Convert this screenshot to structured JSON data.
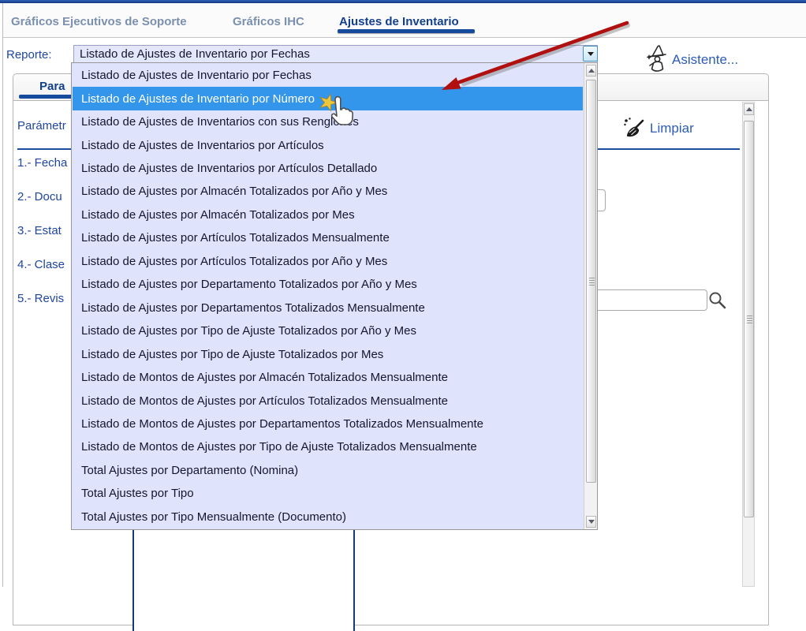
{
  "tabs": [
    {
      "label": "Gráficos Ejecutivos de Soporte",
      "active": false
    },
    {
      "label": "Gráficos IHC",
      "active": false
    },
    {
      "label": "Ajustes de Inventario",
      "active": true
    }
  ],
  "report": {
    "label": "Reporte:",
    "selected_value": "Listado de Ajustes de Inventario por Fechas"
  },
  "assistant": {
    "label": "Asistente...",
    "icon": "wizard-icon"
  },
  "dropdown": {
    "highlighted_index": 1,
    "items": [
      "Listado de Ajustes de Inventario por Fechas",
      "Listado de Ajustes de Inventario por Número",
      "Listado de Ajustes de Inventarios con sus Renglones",
      "Listado de Ajustes de Inventarios por Artículos",
      "Listado de Ajustes de Inventarios por Artículos Detallado",
      "Listado de Ajustes por Almacén Totalizados por Año y Mes",
      "Listado de Ajustes por Almacén Totalizados por Mes",
      "Listado de Ajustes por Artículos Totalizados Mensualmente",
      "Listado de Ajustes por Artículos Totalizados por Año y Mes",
      "Listado de Ajustes por Departamento Totalizados por Año y Mes",
      "Listado de Ajustes por Departamentos Totalizados Mensualmente",
      "Listado de Ajustes por Tipo de Ajuste Totalizados por Año y Mes",
      "Listado de Ajustes por Tipo de Ajuste Totalizados por Mes",
      "Listado de Montos de Ajustes por Almacén Totalizados Mensualmente",
      "Listado de Montos de Ajustes por Artículos Totalizados Mensualmente",
      "Listado de Montos de Ajustes por Departamentos Totalizados Mensualmente",
      "Listado de Montos de Ajustes por Tipo de Ajuste Totalizados Mensualmente",
      "Total Ajustes por Departamento (Nomina)",
      "Total Ajustes por Tipo",
      "Total Ajustes por Tipo Mensualmente (Documento)"
    ]
  },
  "panel": {
    "tab_fragment": "Para",
    "params_header_fragment": "Parámetr",
    "clear_label": "Limpiar",
    "clear_icon": "broom-icon",
    "param_fragments": [
      "1.- Fecha",
      "2.- Docu",
      "3.- Estat",
      "4.- Clase",
      "5.- Revis"
    ],
    "search_value": ""
  },
  "colors": {
    "accent": "#164a9c",
    "highlight": "#3396ea",
    "link": "#2c5cb8",
    "list_bg": "#dfe3fb"
  }
}
